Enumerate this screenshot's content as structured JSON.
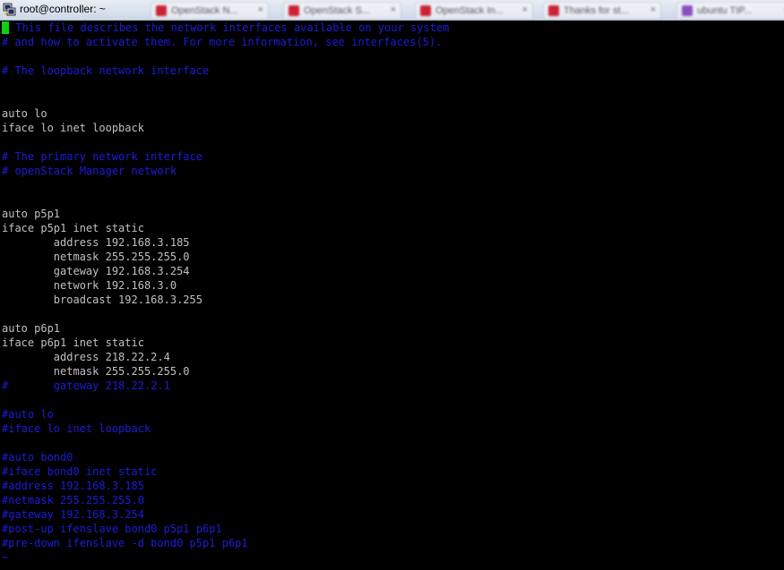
{
  "window": {
    "title": "root@controller: ~",
    "background_tabs": [
      {
        "label": "OpenStack N...",
        "icon_color": "#cc2233"
      },
      {
        "label": "OpenStack S...",
        "icon_color": "#cc2233"
      },
      {
        "label": "OpenStack In...",
        "icon_color": "#cc2233"
      },
      {
        "label": "Thanks for st...",
        "icon_color": "#cc2233"
      },
      {
        "label": "ubuntu TIP...",
        "icon_color": "#8a4fc0"
      }
    ]
  },
  "terminal": {
    "cursor_char": "#",
    "lines": [
      {
        "type": "comment",
        "text": " This file describes the network interfaces available on your system"
      },
      {
        "type": "comment",
        "text": "# and how to activate them. For more information, see interfaces(5)."
      },
      {
        "type": "normal",
        "text": ""
      },
      {
        "type": "comment",
        "text": "# The loopback network interface"
      },
      {
        "type": "normal",
        "text": ""
      },
      {
        "type": "normal",
        "text": ""
      },
      {
        "type": "normal",
        "text": "auto lo"
      },
      {
        "type": "normal",
        "text": "iface lo inet loopback"
      },
      {
        "type": "normal",
        "text": ""
      },
      {
        "type": "comment",
        "text": "# The primary network interface"
      },
      {
        "type": "comment",
        "text": "# openStack Manager network"
      },
      {
        "type": "normal",
        "text": ""
      },
      {
        "type": "normal",
        "text": ""
      },
      {
        "type": "normal",
        "text": "auto p5p1"
      },
      {
        "type": "normal",
        "text": "iface p5p1 inet static"
      },
      {
        "type": "normal",
        "text": "        address 192.168.3.185"
      },
      {
        "type": "normal",
        "text": "        netmask 255.255.255.0"
      },
      {
        "type": "normal",
        "text": "        gateway 192.168.3.254"
      },
      {
        "type": "normal",
        "text": "        network 192.168.3.0"
      },
      {
        "type": "normal",
        "text": "        broadcast 192.168.3.255"
      },
      {
        "type": "normal",
        "text": ""
      },
      {
        "type": "normal",
        "text": "auto p6p1"
      },
      {
        "type": "normal",
        "text": "iface p6p1 inet static"
      },
      {
        "type": "normal",
        "text": "        address 218.22.2.4"
      },
      {
        "type": "normal",
        "text": "        netmask 255.255.255.0"
      },
      {
        "type": "comment",
        "text": "#       gateway 218.22.2.1"
      },
      {
        "type": "normal",
        "text": ""
      },
      {
        "type": "comment",
        "text": "#auto lo"
      },
      {
        "type": "comment",
        "text": "#iface lo inet loopback"
      },
      {
        "type": "normal",
        "text": ""
      },
      {
        "type": "comment",
        "text": "#auto bond0"
      },
      {
        "type": "comment",
        "text": "#iface bond0 inet static"
      },
      {
        "type": "comment",
        "text": "#address 192.168.3.185"
      },
      {
        "type": "comment",
        "text": "#netmask 255.255.255.0"
      },
      {
        "type": "comment",
        "text": "#gateway 192.168.3.254"
      },
      {
        "type": "comment",
        "text": "#post-up ifenslave bond0 p5p1 p6p1"
      },
      {
        "type": "comment",
        "text": "#pre-down ifenslave -d bond0 p5p1 p6p1"
      },
      {
        "type": "tilde",
        "text": "~"
      }
    ]
  },
  "colors": {
    "text_normal": "#c0c0c0",
    "text_comment": "#1c1cd8",
    "cursor": "#10d010",
    "background": "#000000"
  }
}
